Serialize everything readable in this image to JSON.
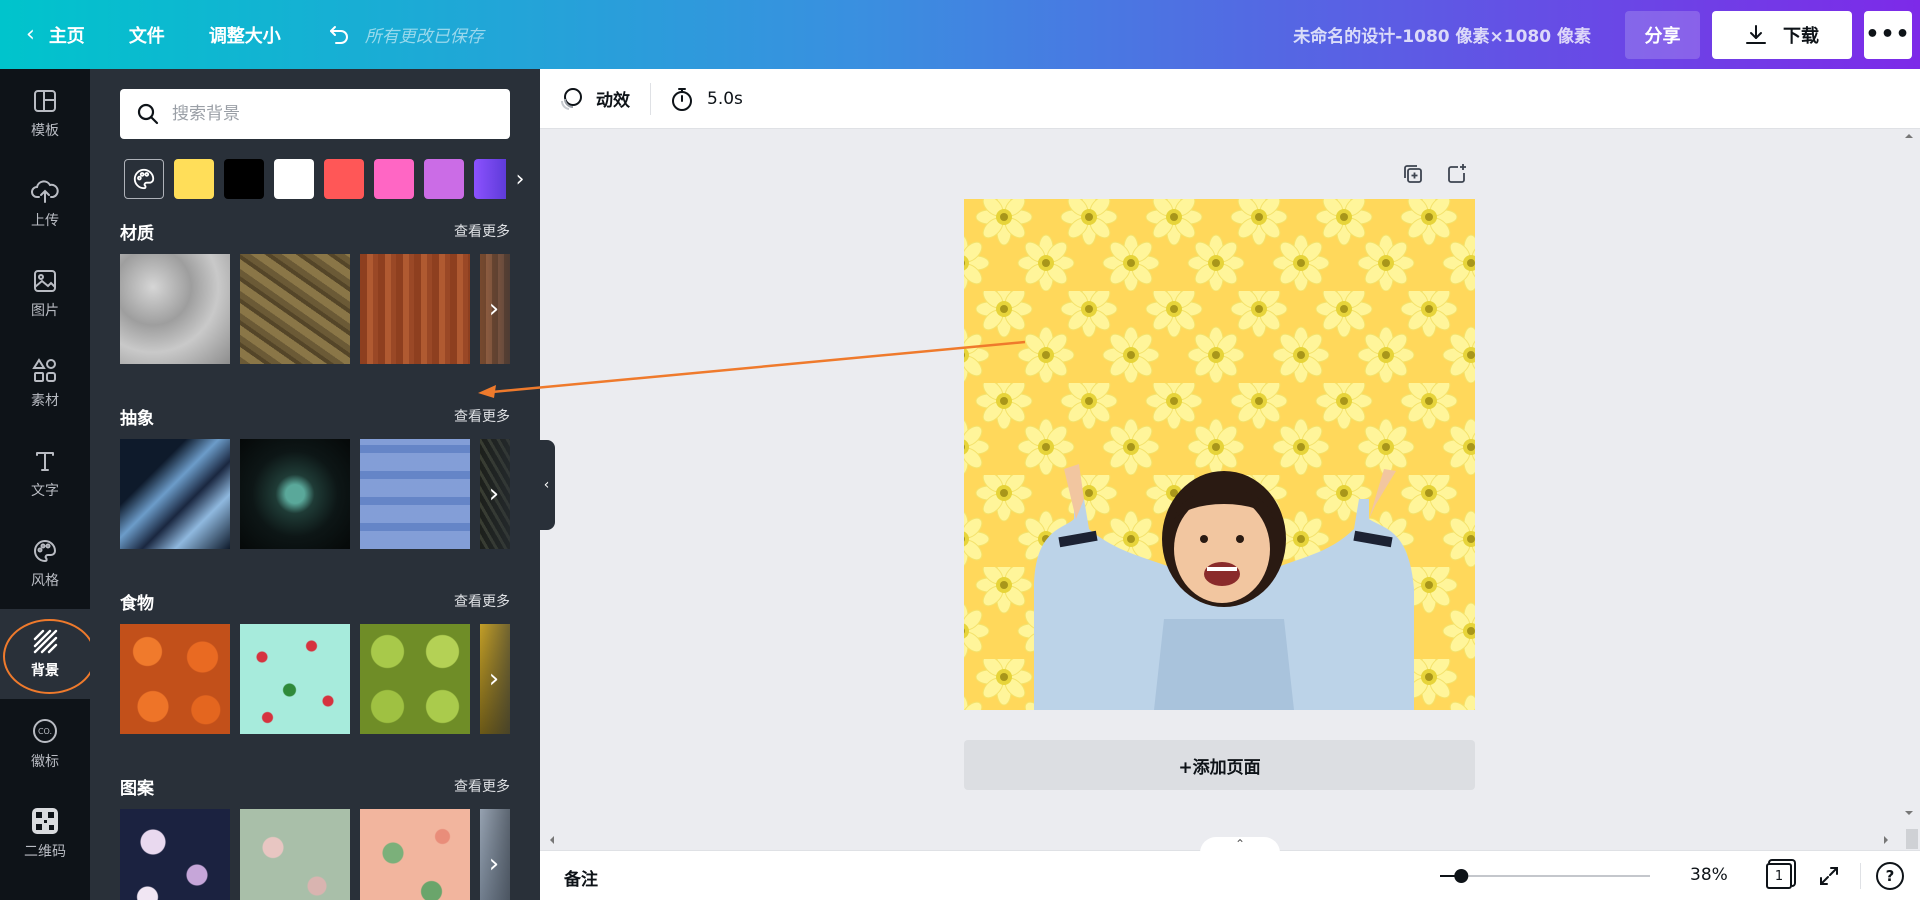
{
  "topbar": {
    "home": "主页",
    "file": "文件",
    "resize": "调整大小",
    "saved_status": "所有更改已保存",
    "design_title": "未命名的设计-1080 像素×1080 像素",
    "share": "分享",
    "download": "下载"
  },
  "rail": {
    "items": [
      {
        "label": "模板",
        "icon": "template-icon"
      },
      {
        "label": "上传",
        "icon": "upload-cloud-icon"
      },
      {
        "label": "图片",
        "icon": "image-icon"
      },
      {
        "label": "素材",
        "icon": "elements-icon"
      },
      {
        "label": "文字",
        "icon": "text-icon"
      },
      {
        "label": "风格",
        "icon": "palette-icon"
      },
      {
        "label": "背景",
        "icon": "background-stripes-icon"
      },
      {
        "label": "徽标",
        "icon": "logo-icon"
      },
      {
        "label": "二维码",
        "icon": "qrcode-icon"
      }
    ],
    "active": "背景",
    "highlight_color": "#ef7a2c"
  },
  "panel": {
    "search_placeholder": "搜索背景",
    "colors": [
      "#ffde59",
      "#000000",
      "#ffffff",
      "#ff5757",
      "#ff66c4",
      "#cb6ce6",
      "#8c52ff"
    ],
    "sections": [
      {
        "title": "材质",
        "more": "查看更多"
      },
      {
        "title": "抽象",
        "more": "查看更多"
      },
      {
        "title": "食物",
        "more": "查看更多"
      },
      {
        "title": "图案",
        "more": "查看更多"
      }
    ]
  },
  "editor": {
    "animate": "动效",
    "duration": "5.0s",
    "add_page": "+添加页面",
    "canvas_background_color": "#ffd85b"
  },
  "bottombar": {
    "notes": "备注",
    "zoom": "38%",
    "zoom_level": 0.05,
    "page_number": "1"
  }
}
